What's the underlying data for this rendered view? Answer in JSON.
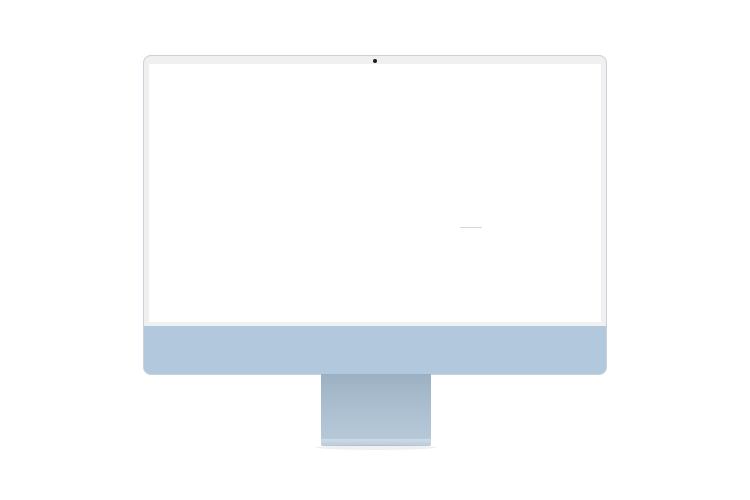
{
  "device": {
    "type": "desktop computer mockup",
    "screen_state": "blank",
    "colors": {
      "body": "#b2c8dc",
      "bezel": "#f0f0f0",
      "screen": "#ffffff",
      "background": "#ffffff"
    }
  }
}
